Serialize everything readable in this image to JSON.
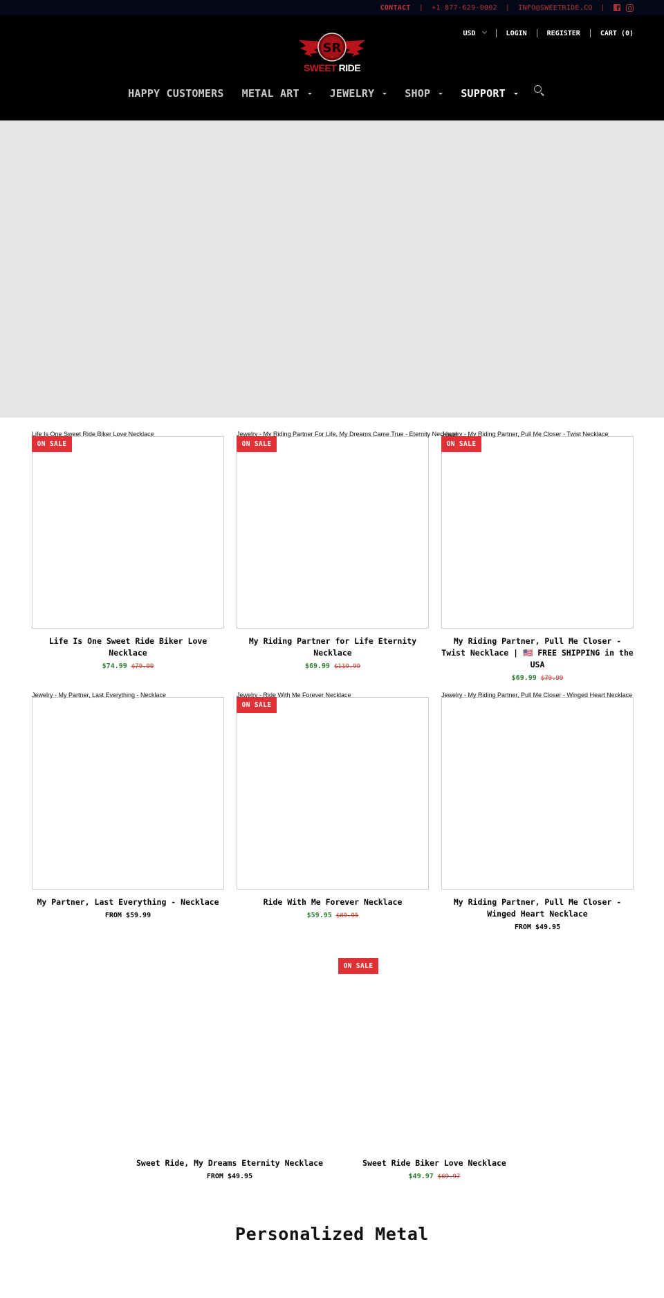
{
  "topbar": {
    "contact": "CONTACT",
    "phone": "+1 877-629-0002",
    "email": "INFO@SWEETRIDE.CO",
    "social": [
      "facebook-icon",
      "instagram-icon"
    ],
    "color": "#b3363c"
  },
  "header": {
    "logo": {
      "word1": "SWEET",
      "word2": "RIDE",
      "monogram": "SR"
    },
    "account": {
      "currency": "USD",
      "login": "LOGIN",
      "register": "REGISTER",
      "cart": "CART (0)"
    },
    "nav": [
      {
        "label": "HAPPY CUSTOMERS",
        "dropdown": false
      },
      {
        "label": "METAL ART",
        "dropdown": true
      },
      {
        "label": "JEWELRY",
        "dropdown": true
      },
      {
        "label": "SHOP",
        "dropdown": true
      },
      {
        "label": "SUPPORT",
        "dropdown": true,
        "active": true
      }
    ],
    "search_icon": "search-icon"
  },
  "badge_label": "ON SALE",
  "products": [
    {
      "alt": "Life Is One Sweet Ride Biker Love Necklace",
      "title": "Life Is One Sweet Ride Biker Love Necklace",
      "on_sale": true,
      "price": "$74.99",
      "compare_price": "$79.99"
    },
    {
      "alt": "Jewelry - My Riding Partner For Life, My Dreams Came True - Eternity Necklace",
      "title": "My Riding Partner for Life Eternity Necklace",
      "on_sale": true,
      "price": "$69.99",
      "compare_price": "$119.99"
    },
    {
      "alt": "Jewelry - My Riding Partner, Pull Me Closer - Twist Necklace",
      "title": "My Riding Partner, Pull Me Closer - Twist Necklace | 🇺🇸 FREE SHIPPING in the USA",
      "on_sale": true,
      "price": "$69.99",
      "compare_price": "$79.99"
    },
    {
      "alt": "Jewelry - My Partner, Last Everything - Necklace",
      "title": "My Partner, Last Everything - Necklace",
      "on_sale": false,
      "price": "FROM $59.99"
    },
    {
      "alt": "Jewelry - Ride With Me Forever Necklace",
      "title": "Ride With Me Forever Necklace",
      "on_sale": true,
      "price": "$59.95",
      "compare_price": "$89.95"
    },
    {
      "alt": "Jewelry - My Riding Partner, Pull Me Closer - Winged Heart Necklace",
      "title": "My Riding Partner, Pull Me Closer - Winged Heart Necklace",
      "on_sale": false,
      "price": "FROM $49.95"
    },
    {
      "alt": "",
      "title": "Sweet Ride, My Dreams Eternity Necklace",
      "on_sale": false,
      "price": "FROM $49.95"
    },
    {
      "alt": "",
      "title": "Sweet Ride Biker Love Necklace",
      "on_sale": true,
      "price": "$49.97",
      "compare_price": "$69.97"
    }
  ],
  "section_title": "Personalized Metal",
  "colors": {
    "badge": "#e03136",
    "sale_price": "#2e7d32",
    "compare_price": "#c0392b",
    "hero_bg": "#e5e5e5",
    "header_bg": "#000000"
  }
}
